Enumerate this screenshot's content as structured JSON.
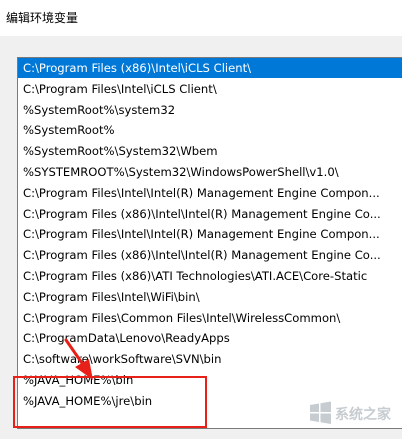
{
  "window": {
    "title": "编辑环境变量"
  },
  "path_list": {
    "items": [
      "C:\\Program Files (x86)\\Intel\\iCLS Client\\",
      "C:\\Program Files\\Intel\\iCLS Client\\",
      "%SystemRoot%\\system32",
      "%SystemRoot%",
      "%SystemRoot%\\System32\\Wbem",
      "%SYSTEMROOT%\\System32\\WindowsPowerShell\\v1.0\\",
      "C:\\Program Files\\Intel\\Intel(R) Management Engine Compon...",
      "C:\\Program Files (x86)\\Intel\\Intel(R) Management Engine Co...",
      "C:\\Program Files\\Intel\\Intel(R) Management Engine Compon...",
      "C:\\Program Files (x86)\\Intel\\Intel(R) Management Engine Co...",
      "C:\\Program Files (x86)\\ATI Technologies\\ATI.ACE\\Core-Static",
      "C:\\Program Files\\Intel\\WiFi\\bin\\",
      "C:\\Program Files\\Common Files\\Intel\\WirelessCommon\\",
      "C:\\ProgramData\\Lenovo\\ReadyApps",
      "C:\\software\\workSoftware\\SVN\\bin",
      "%JAVA_HOME%\\bin",
      "%JAVA_HOME%\\jre\\bin"
    ],
    "selected_index": 0
  },
  "annotation": {
    "highlight_color": "#e8201a",
    "arrow_color": "#e8201a"
  },
  "colors": {
    "selection": "#0078d7",
    "dialog_background": "#f0f0f0"
  },
  "watermark": {
    "icon": "windows-logo-icon",
    "text": "系统之家"
  }
}
